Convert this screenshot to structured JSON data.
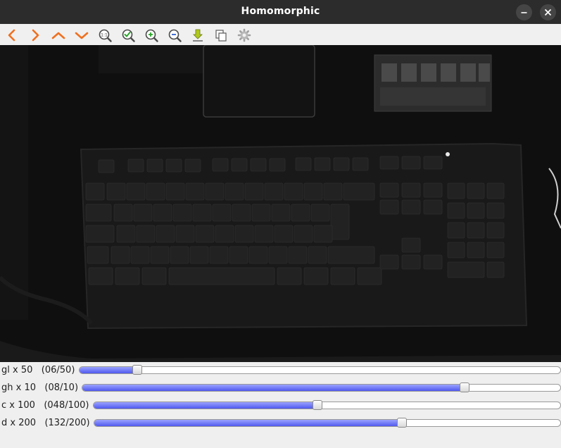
{
  "window": {
    "title": "Homomorphic"
  },
  "toolbar": {
    "buttons": [
      {
        "name": "pan-left-button",
        "icon": "chevron-left-icon"
      },
      {
        "name": "pan-right-button",
        "icon": "chevron-right-icon"
      },
      {
        "name": "pan-up-button",
        "icon": "chevron-up-icon"
      },
      {
        "name": "pan-down-button",
        "icon": "chevron-down-icon"
      },
      {
        "name": "zoom-original-button",
        "icon": "zoom-original-icon"
      },
      {
        "name": "zoom-fit-button",
        "icon": "zoom-fit-icon"
      },
      {
        "name": "zoom-in-button",
        "icon": "zoom-in-icon"
      },
      {
        "name": "zoom-out-button",
        "icon": "zoom-out-icon"
      },
      {
        "name": "save-button",
        "icon": "save-download-icon"
      },
      {
        "name": "copy-button",
        "icon": "copy-icon"
      },
      {
        "name": "properties-button",
        "icon": "gear-icon"
      }
    ]
  },
  "trackbars": [
    {
      "name": "gl",
      "label": "gl x 50",
      "value_text": "(06/50)",
      "value": 6,
      "max": 50
    },
    {
      "name": "gh",
      "label": "gh x 10",
      "value_text": "(08/10)",
      "value": 8,
      "max": 10
    },
    {
      "name": "c",
      "label": "c x 100",
      "value_text": "(048/100)",
      "value": 48,
      "max": 100
    },
    {
      "name": "d",
      "label": "d x 200",
      "value_text": "(132/200)",
      "value": 132,
      "max": 200
    }
  ],
  "colors": {
    "titlebar": "#2c2c2c",
    "toolbar_arrows": "#f07020",
    "slider_fill": "#5a62f0",
    "image_background": "#0e0e0e"
  }
}
